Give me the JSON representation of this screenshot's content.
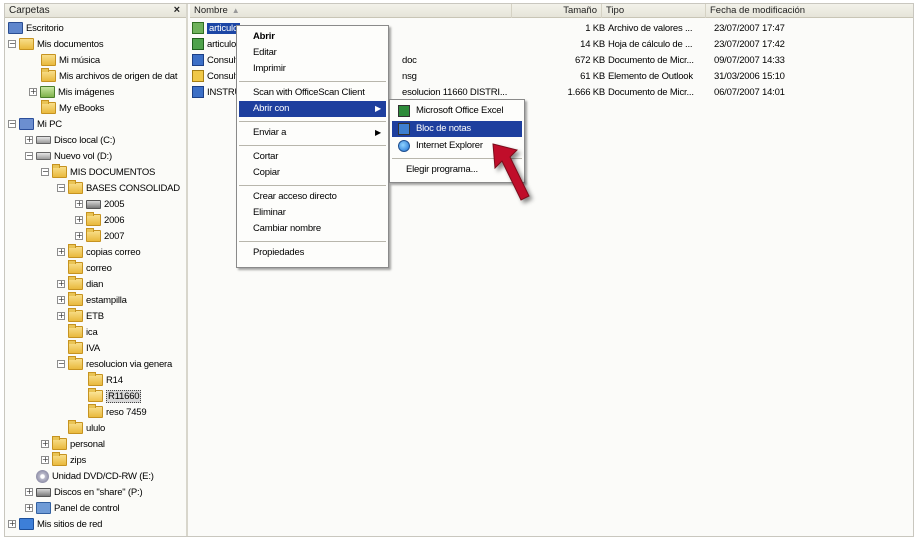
{
  "folders_pane": {
    "title": "Carpetas",
    "close": "×",
    "items": [
      {
        "label": "Escritorio"
      },
      {
        "label": "Mis documentos"
      },
      {
        "label": "Mi música"
      },
      {
        "label": "Mis archivos de origen de dat"
      },
      {
        "label": "Mis imágenes"
      },
      {
        "label": "My eBooks"
      },
      {
        "label": "Mi PC"
      },
      {
        "label": "Disco local (C:)"
      },
      {
        "label": "Nuevo vol (D:)"
      },
      {
        "label": "MIS DOCUMENTOS"
      },
      {
        "label": "BASES CONSOLIDAD"
      },
      {
        "label": "2005"
      },
      {
        "label": "2006"
      },
      {
        "label": "2007"
      },
      {
        "label": "copias correo"
      },
      {
        "label": "correo"
      },
      {
        "label": "dian"
      },
      {
        "label": "estampilla"
      },
      {
        "label": "ETB"
      },
      {
        "label": "ica"
      },
      {
        "label": "IVA"
      },
      {
        "label": "resolucion via genera"
      },
      {
        "label": "R14"
      },
      {
        "label": "R11660"
      },
      {
        "label": "reso 7459"
      },
      {
        "label": "ululo"
      },
      {
        "label": "personal"
      },
      {
        "label": "zips"
      },
      {
        "label": "Unidad DVD/CD-RW (E:)"
      },
      {
        "label": "Discos en \"share\" (P:)"
      },
      {
        "label": "Panel de control"
      },
      {
        "label": "Mis sitios de red"
      }
    ]
  },
  "columns": {
    "name": "Nombre",
    "sort_indicator": "▲",
    "size": "Tamaño",
    "type": "Tipo",
    "date": "Fecha de modificación"
  },
  "files": [
    {
      "name": "articulo",
      "size": "1 KB",
      "type": "Archivo de valores ...",
      "date": "23/07/2007 17:47"
    },
    {
      "name": "articulo",
      "size": "14 KB",
      "type": "Hoja de cálculo de ...",
      "date": "23/07/2007 17:42"
    },
    {
      "name": "Consult",
      "name_tail": "doc",
      "size": "672 KB",
      "type": "Documento de Micr...",
      "date": "09/07/2007 14:33"
    },
    {
      "name": "Consult",
      "name_tail": "nsg",
      "size": "61 KB",
      "type": "Elemento de Outlook",
      "date": "31/03/2006 15:10"
    },
    {
      "name": "INSTRU",
      "name_tail": "esolucion 11660 DISTRI...",
      "size": "1.666 KB",
      "type": "Documento de Micr...",
      "date": "06/07/2007 14:01"
    }
  ],
  "context_menu": {
    "items": [
      {
        "label": "Abrir"
      },
      {
        "label": "Editar"
      },
      {
        "label": "Imprimir"
      },
      {
        "label": "Scan with OfficeScan Client"
      },
      {
        "label": "Abrir con"
      },
      {
        "label": "Enviar a"
      },
      {
        "label": "Cortar"
      },
      {
        "label": "Copiar"
      },
      {
        "label": "Crear acceso directo"
      },
      {
        "label": "Eliminar"
      },
      {
        "label": "Cambiar nombre"
      },
      {
        "label": "Propiedades"
      }
    ],
    "submenu_arrow": "▶"
  },
  "open_with_menu": {
    "items": [
      {
        "label": "Microsoft Office Excel",
        "icon": "excel-icon"
      },
      {
        "label": "Bloc de notas",
        "icon": "notepad-icon"
      },
      {
        "label": "Internet Explorer",
        "icon": "internet-explorer-icon"
      },
      {
        "label": "Elegir programa..."
      }
    ]
  },
  "colors": {
    "highlight": "#1e3f9e",
    "arrow": "#c0102a"
  }
}
